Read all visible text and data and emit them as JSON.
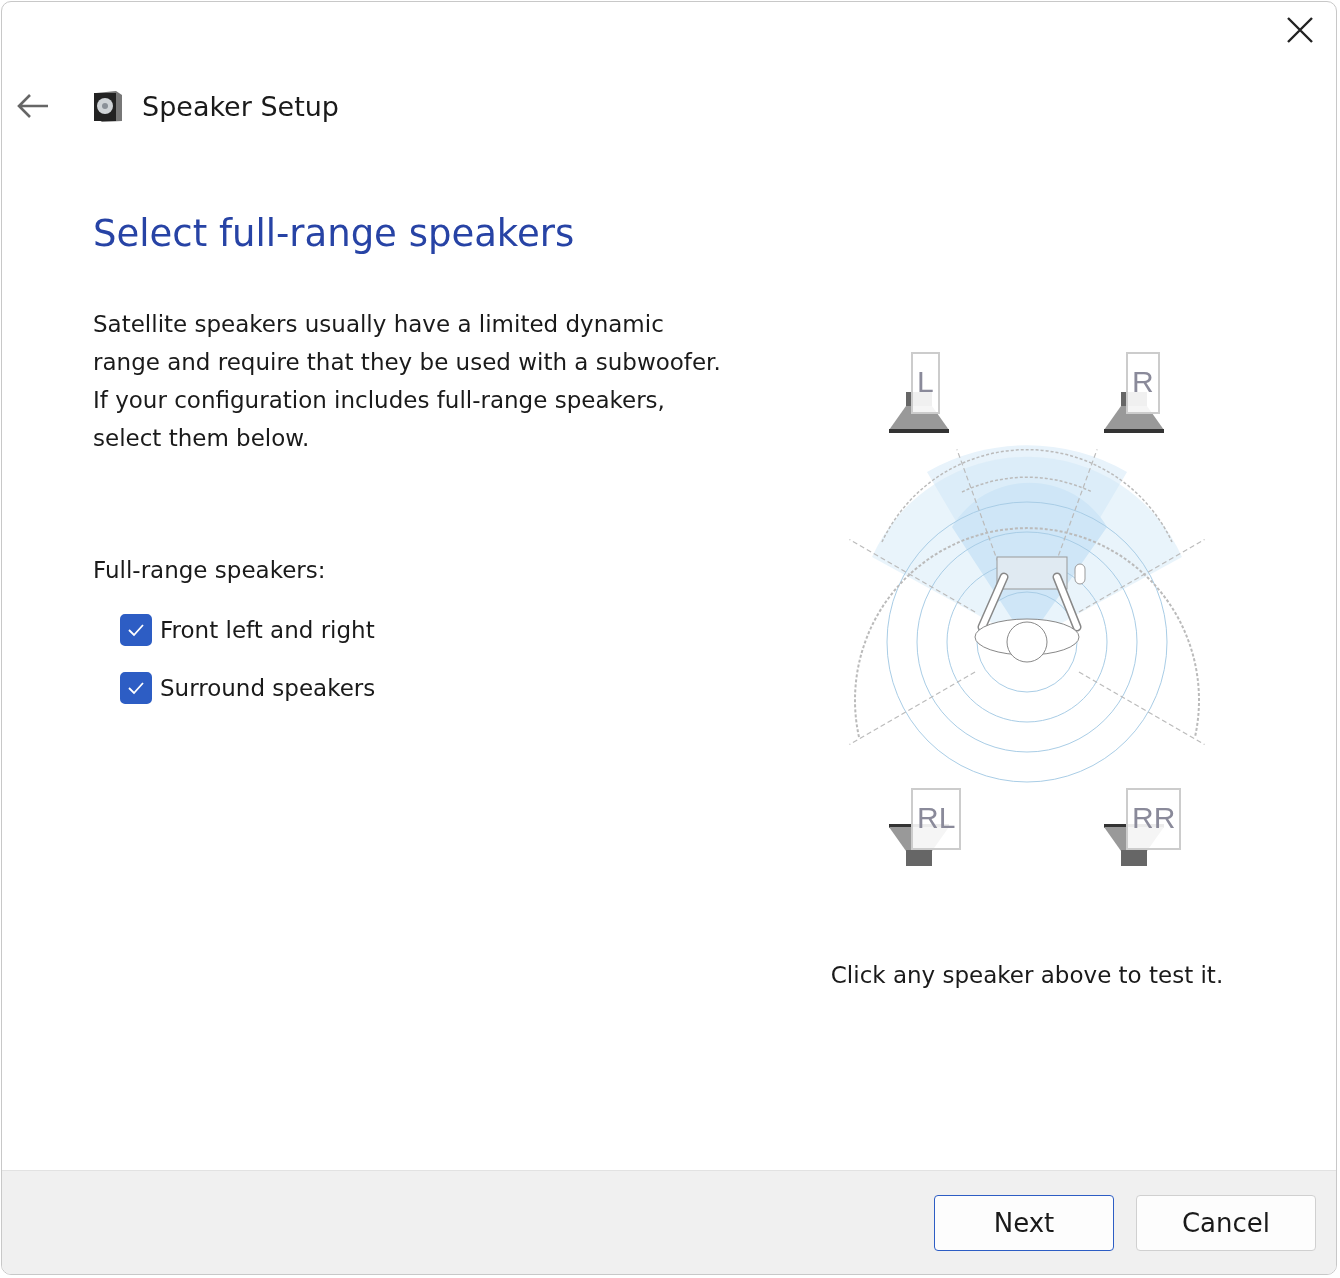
{
  "window": {
    "title": "Speaker Setup"
  },
  "heading": "Select full-range speakers",
  "description": "Satellite speakers usually have a limited dynamic range and require that they be used with a subwoofer.  If your configuration includes full-range speakers, select them below.",
  "group_label": "Full-range speakers:",
  "options": [
    {
      "label": "Front left and right",
      "checked": true
    },
    {
      "label": "Surround speakers",
      "checked": true
    }
  ],
  "speakers": [
    {
      "label": "L",
      "kind": "front"
    },
    {
      "label": "R",
      "kind": "front"
    },
    {
      "label": "RL",
      "kind": "rear"
    },
    {
      "label": "RR",
      "kind": "rear"
    }
  ],
  "caption": "Click any speaker above to test it.",
  "buttons": [
    {
      "label": "Next",
      "default": true
    },
    {
      "label": "Cancel",
      "default": false
    }
  ]
}
